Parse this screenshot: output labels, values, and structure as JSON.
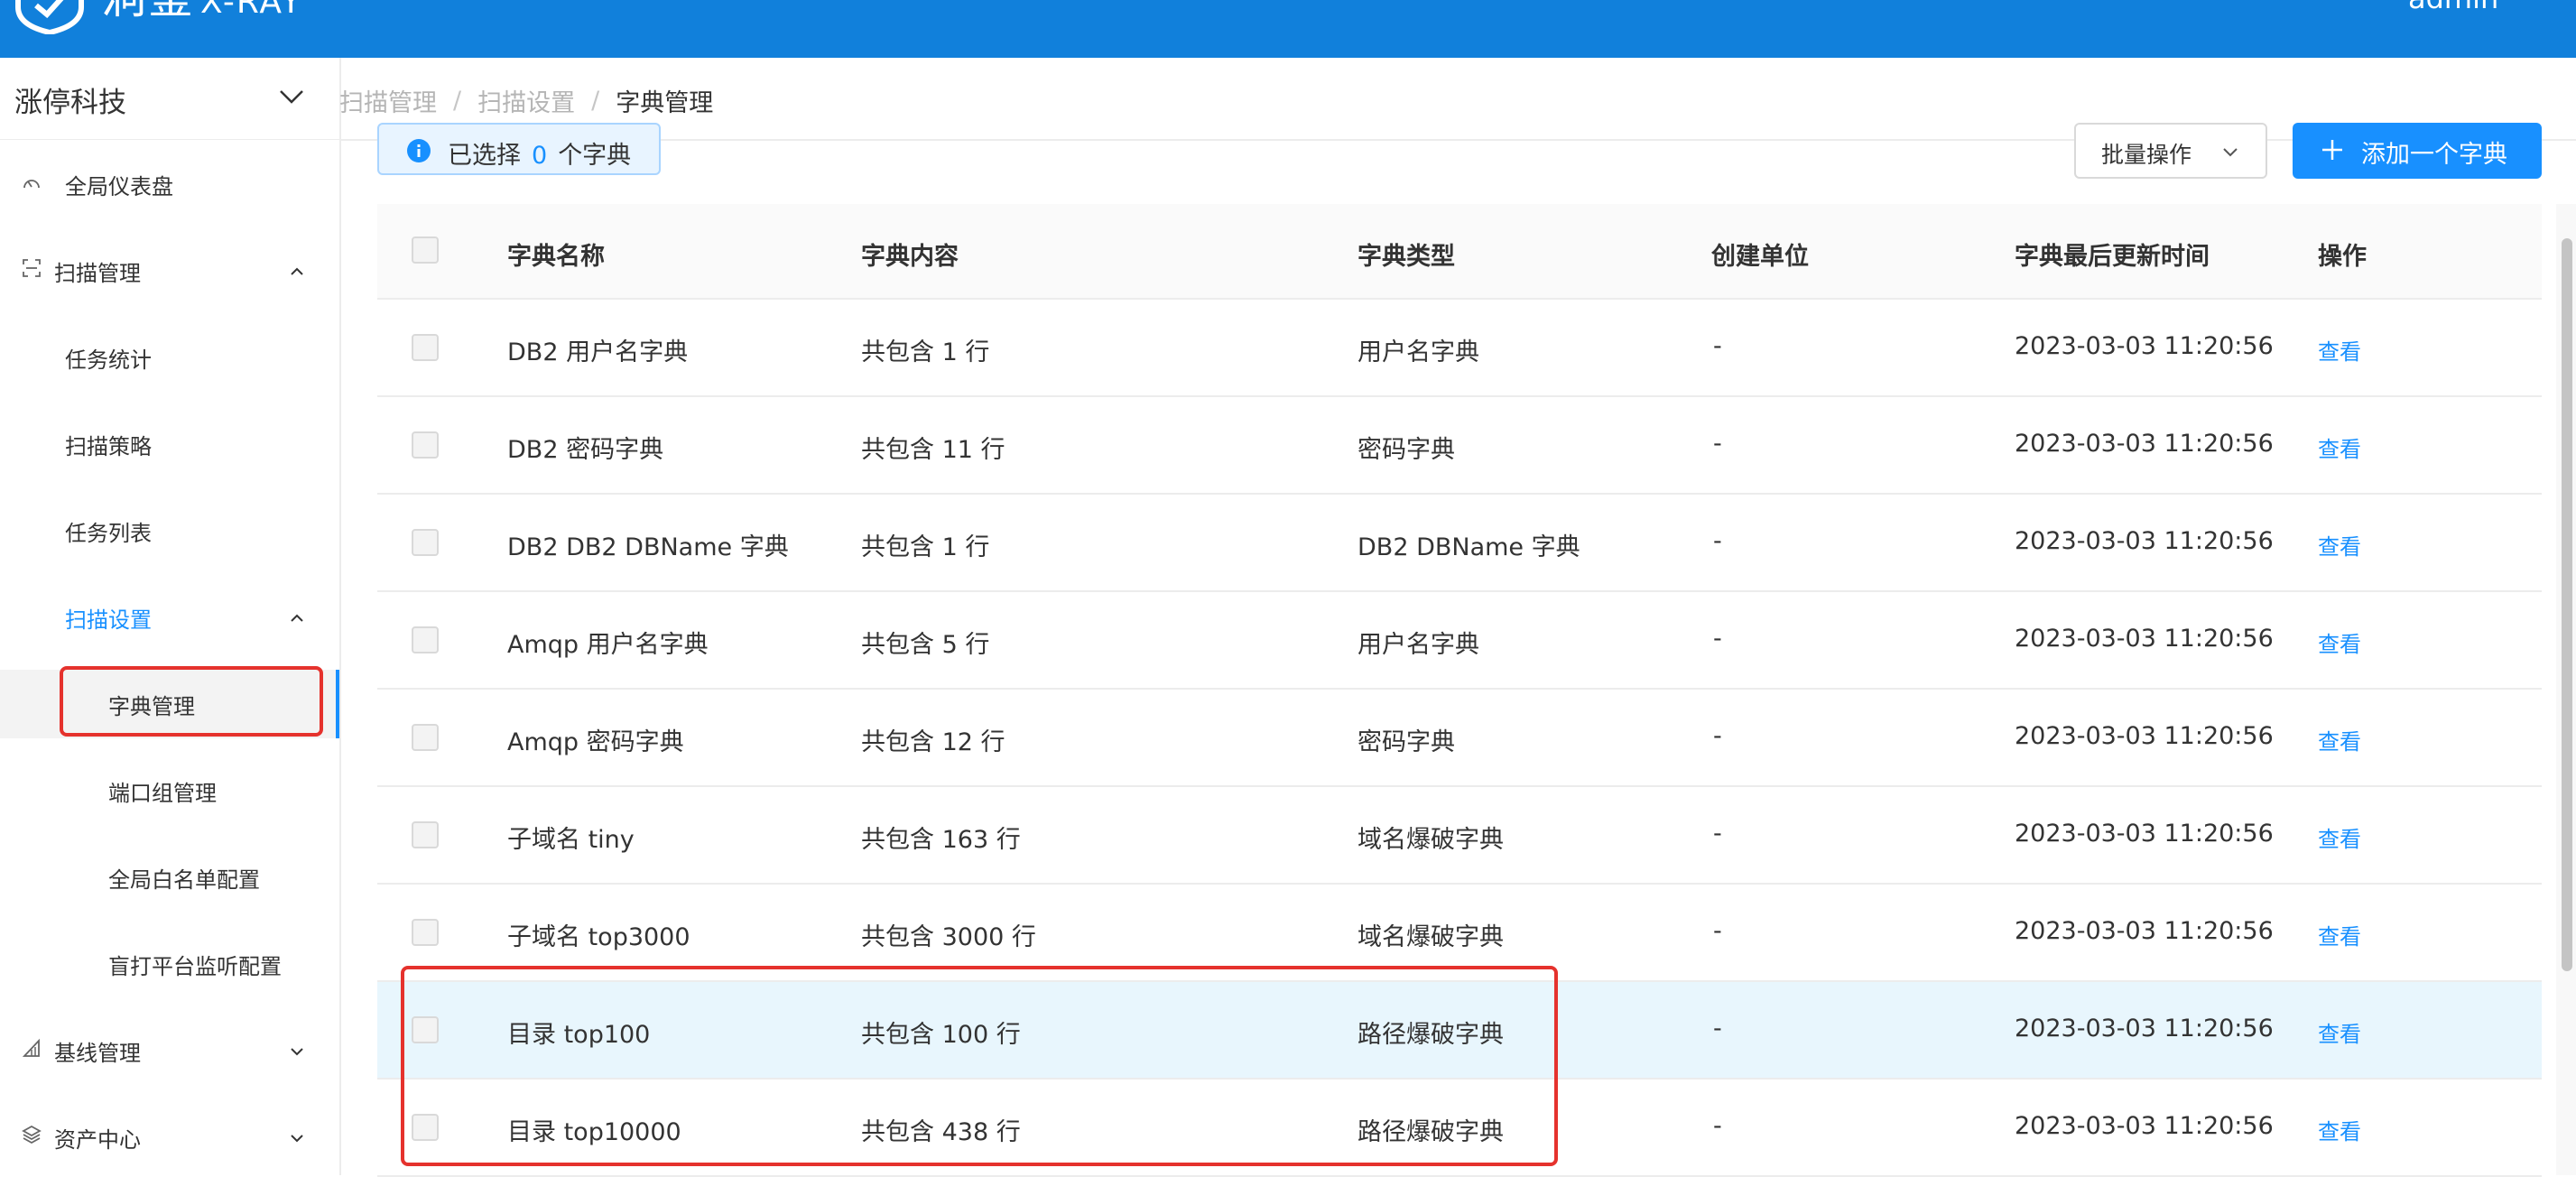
{
  "header": {
    "logo_text": "洞鉴",
    "logo_sub": "X-RAY",
    "user": "admin"
  },
  "org": {
    "name": "涨停科技"
  },
  "breadcrumb": [
    "扫描管理",
    "扫描设置",
    "字典管理"
  ],
  "sidebar": {
    "dashboard": "全局仪表盘",
    "scan_mgmt": "扫描管理",
    "task_stats": "任务统计",
    "scan_policy": "扫描策略",
    "task_list": "任务列表",
    "scan_settings": "扫描设置",
    "dict_mgmt": "字典管理",
    "port_group": "端口组管理",
    "whitelist": "全局白名单配置",
    "blind_platform": "盲打平台监听配置",
    "baseline_mgmt": "基线管理",
    "asset_center": "资产中心"
  },
  "toolbar": {
    "selected_prefix": "已选择",
    "selected_count": "0",
    "selected_suffix": "个字典",
    "batch_label": "批量操作",
    "add_label": "添加一个字典"
  },
  "table": {
    "columns": [
      "字典名称",
      "字典内容",
      "字典类型",
      "创建单位",
      "字典最后更新时间",
      "操作"
    ],
    "rows": [
      {
        "name": "DB2 用户名字典",
        "content": "共包含 1 行",
        "type": "用户名字典",
        "unit": "-",
        "updated": "2023-03-03 11:20:56",
        "action": "查看"
      },
      {
        "name": "DB2 密码字典",
        "content": "共包含 11 行",
        "type": "密码字典",
        "unit": "-",
        "updated": "2023-03-03 11:20:56",
        "action": "查看"
      },
      {
        "name": "DB2 DB2 DBName 字典",
        "content": "共包含 1 行",
        "type": "DB2 DBName 字典",
        "unit": "-",
        "updated": "2023-03-03 11:20:56",
        "action": "查看"
      },
      {
        "name": "Amqp 用户名字典",
        "content": "共包含 5 行",
        "type": "用户名字典",
        "unit": "-",
        "updated": "2023-03-03 11:20:56",
        "action": "查看"
      },
      {
        "name": "Amqp 密码字典",
        "content": "共包含 12 行",
        "type": "密码字典",
        "unit": "-",
        "updated": "2023-03-03 11:20:56",
        "action": "查看"
      },
      {
        "name": "子域名 tiny",
        "content": "共包含 163 行",
        "type": "域名爆破字典",
        "unit": "-",
        "updated": "2023-03-03 11:20:56",
        "action": "查看"
      },
      {
        "name": "子域名 top3000",
        "content": "共包含 3000 行",
        "type": "域名爆破字典",
        "unit": "-",
        "updated": "2023-03-03 11:20:56",
        "action": "查看"
      },
      {
        "name": "目录 top100",
        "content": "共包含 100 行",
        "type": "路径爆破字典",
        "unit": "-",
        "updated": "2023-03-03 11:20:56",
        "action": "查看"
      },
      {
        "name": "目录 top10000",
        "content": "共包含 438 行",
        "type": "路径爆破字典",
        "unit": "-",
        "updated": "2023-03-03 11:20:56",
        "action": "查看"
      }
    ]
  },
  "colors": {
    "header_bg": "#1180db",
    "accent": "#1890ff",
    "highlight_border": "#e5322d",
    "row_highlight": "#e8f6fd"
  },
  "icons": {
    "logo": "shield-logo-icon",
    "dashboard": "gauge-icon",
    "scan": "scan-frame-icon",
    "baseline": "triangle-ruler-icon",
    "asset": "layers-icon",
    "info": "info-circle-icon",
    "plus": "plus-icon",
    "chevron": "chevron-down-icon"
  }
}
